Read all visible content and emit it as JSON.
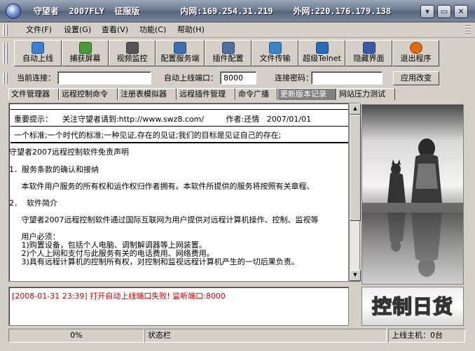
{
  "window": {
    "title": "守望者  2007FLY  征服版        内网:169.254.31.219    外网:220.176.179.138",
    "minimize_glyph": "▾",
    "maximize_glyph": "▭",
    "close_glyph": "✕"
  },
  "menu": {
    "items": [
      "文件(F)",
      "设置(G)",
      "查看(V)",
      "功能(C)",
      "帮助(H)"
    ]
  },
  "toolbar": {
    "buttons": [
      {
        "label": "自动上线",
        "icon": "auto-online-icon",
        "color": "#3a7fd0"
      },
      {
        "label": "捕获屏幕",
        "icon": "capture-screen-icon",
        "color": "#4a9a3a"
      },
      {
        "label": "视频监控",
        "icon": "video-monitor-icon",
        "color": "#555555"
      },
      {
        "label": "配置服务端",
        "icon": "config-server-icon",
        "color": "#3d6fb0"
      },
      {
        "label": "插件配置",
        "icon": "plugin-config-icon",
        "color": "#4f6f9f"
      },
      {
        "label": "文件传输",
        "icon": "file-transfer-icon",
        "color": "#3b86c8"
      },
      {
        "label": "超级Telnet",
        "icon": "telnet-icon",
        "color": "#2a6ab8"
      },
      {
        "label": "隐藏界面",
        "icon": "hide-ui-icon",
        "color": "#3a5aa8"
      },
      {
        "label": "退出程序",
        "icon": "power-icon",
        "color": "#e06a10"
      }
    ]
  },
  "connection": {
    "current_label": "当前连接：",
    "current_value": "",
    "port_label": "自动上线端口：",
    "port_value": "8000",
    "password_label": "连接密码：",
    "password_value": "",
    "apply_label": "应用改变"
  },
  "tabs": [
    "文件管理器",
    "远程控制命令",
    "注册表模拟器",
    "远程插件管理",
    "命令广播",
    "更新版本记录",
    "网站压力测试"
  ],
  "active_tab": 5,
  "content": {
    "notice": "  重要提示：    关注守望者请到:http://www.swz8.com/         作者:还情   2007/01/01",
    "motto": "  一个标准;一个时代的标准;一种见证,存在的见证;我们的目标是见证自己的存在;",
    "heading": "守望者2007远程控制软件免责声明",
    "s1": "1．服务条款的确认和接纳",
    "s1_body": "     本软件用户服务的所有权和运作权归作者拥有。本软件所提供的服务将按照有关章程、",
    "s2": "2．  软件简介",
    "s2_body": "     守望者2007远程控制软件通过国际互联网为用户提供对远程计算机操作、控制、监视等",
    "req_title": "     用户必须：",
    "req1": "     1)购置设备，包括个人电脑、调制解调器等上网装置。",
    "req2": "     2)个人上网和支付与此服务有关的电话费用、网络费用。",
    "req3": "     3)具有远程计算机的控制所有权，对控制和监视远程计算机产生的一切后果负责。"
  },
  "log": {
    "entry": "[2008-01-31 23:39] 打开自动上线端口失败! 监听端口:8000"
  },
  "brand_text": "控制日货",
  "status": {
    "progress_text": "0%",
    "status_label": "状态栏",
    "online_hosts": "上线主机：0台"
  },
  "scroll_up_glyph": "▲",
  "scroll_down_glyph": "▼"
}
